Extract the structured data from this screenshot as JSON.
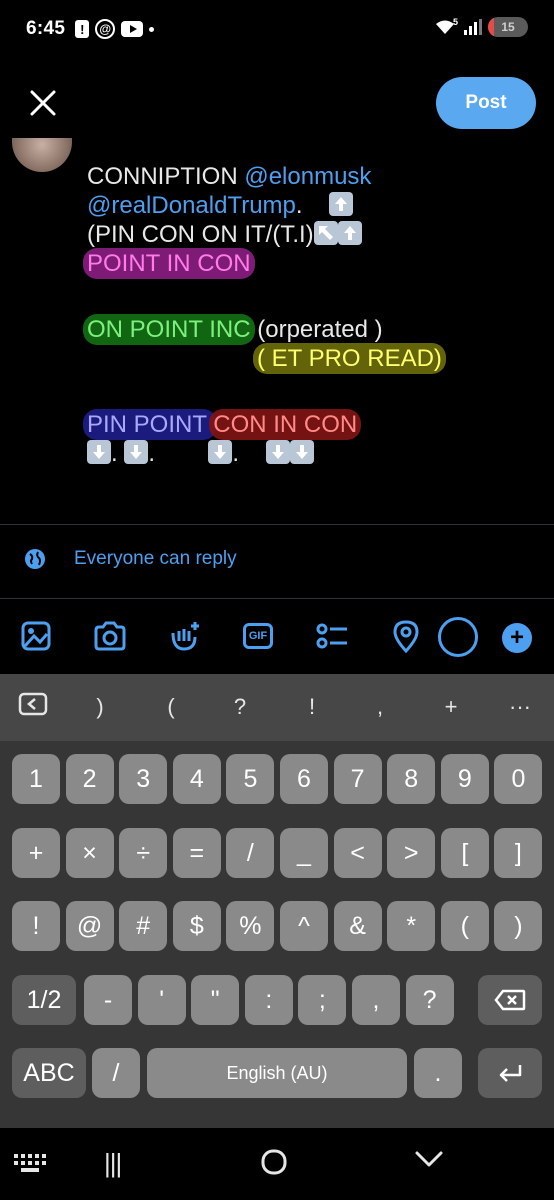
{
  "status_bar": {
    "time": "6:45",
    "alert_glyph": "!",
    "at_glyph": "@",
    "network_label": "5",
    "battery": "15",
    "battery_level": 0.15,
    "icons": [
      "alert-icon",
      "at-sign-icon",
      "youtube-icon",
      "wifi-icon",
      "signal-icon",
      "battery-icon"
    ]
  },
  "compose": {
    "close_icon": "close-icon",
    "post_label": "Post",
    "tweet_lines": {
      "l1_text": "CONNIPTION ",
      "l1_mention": "@elonmusk",
      "l2_mention": "@realDonaldTrump",
      "l2_text": ".    ",
      "l3_text": "(PIN CON ON IT/(T.I)",
      "l4_hl": "POINT IN CON",
      "l6_hl": "ON POINT INC",
      "l6_text": " (orperated )",
      "l7_hl": "( ET PRO READ)",
      "l9_hl_blue": "PIN POINT ",
      "l9_hl_red": "CON IN CON",
      "l10_sep1": ".",
      "l10_sep2": ".",
      "l10_sep3": "."
    },
    "reply_setting": "Everyone can reply"
  },
  "toolbar": {
    "icons": [
      "image-icon",
      "camera-icon",
      "grok-icon",
      "gif-icon",
      "poll-icon",
      "location-icon",
      "char-count-ring",
      "add-post-icon"
    ],
    "gif_label": "GIF",
    "plus_glyph": "+",
    "accent": "#4d9ff0"
  },
  "keyboard": {
    "suggestions": [
      ")",
      "(",
      "?",
      "!",
      ",",
      "+",
      "···"
    ],
    "row1": [
      "1",
      "2",
      "3",
      "4",
      "5",
      "6",
      "7",
      "8",
      "9",
      "0"
    ],
    "row2": [
      "+",
      "×",
      "÷",
      "=",
      "/",
      "_",
      "<",
      ">",
      "[",
      "]"
    ],
    "row3": [
      "!",
      "@",
      "#",
      "$",
      "%",
      "^",
      "&",
      "*",
      "(",
      ")"
    ],
    "row4": [
      "1/2",
      "-",
      "'",
      "\"",
      ":",
      ";",
      ",",
      "?"
    ],
    "row5": {
      "abc": "ABC",
      "slash": "/",
      "space": "English (AU)",
      "period": "."
    }
  },
  "navbar": {
    "icons": [
      "keyboard-icon",
      "recents-icon",
      "home-icon",
      "back-icon"
    ],
    "recents_glyph": "|||"
  }
}
